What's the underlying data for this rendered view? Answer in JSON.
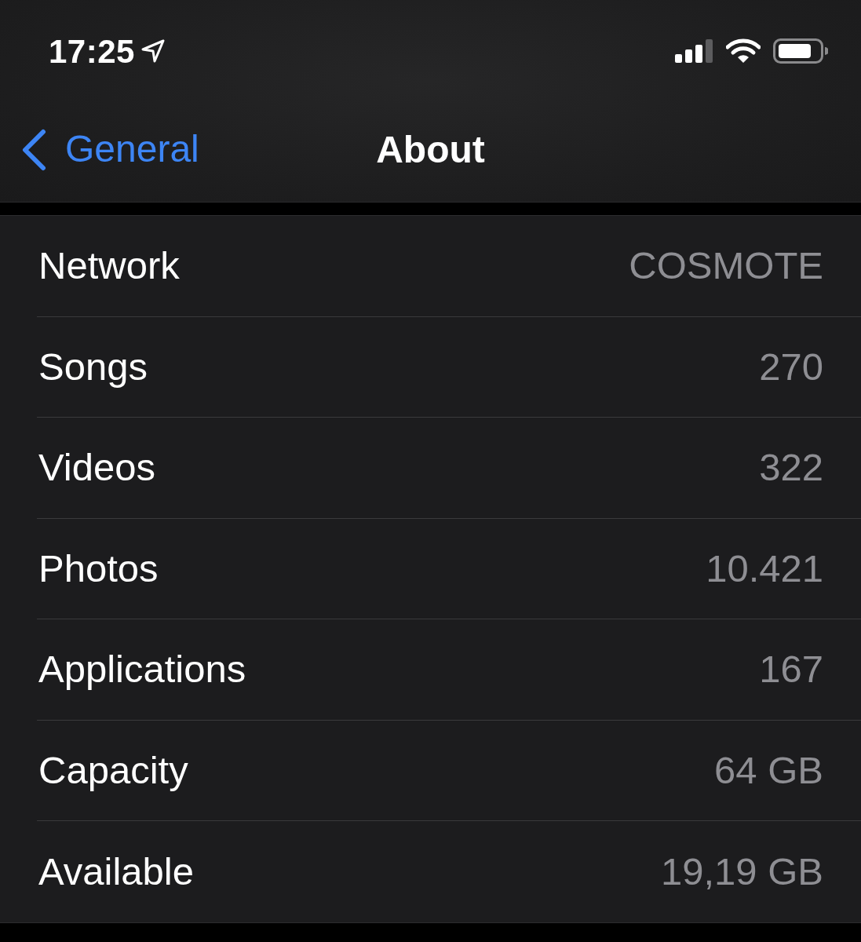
{
  "status_bar": {
    "time": "17:25"
  },
  "nav_bar": {
    "back_label": "General",
    "title": "About"
  },
  "rows": [
    {
      "label": "Network",
      "value": "COSMOTE"
    },
    {
      "label": "Songs",
      "value": "270"
    },
    {
      "label": "Videos",
      "value": "322"
    },
    {
      "label": "Photos",
      "value": "10.421"
    },
    {
      "label": "Applications",
      "value": "167"
    },
    {
      "label": "Capacity",
      "value": "64 GB"
    },
    {
      "label": "Available",
      "value": "19,19 GB"
    }
  ]
}
